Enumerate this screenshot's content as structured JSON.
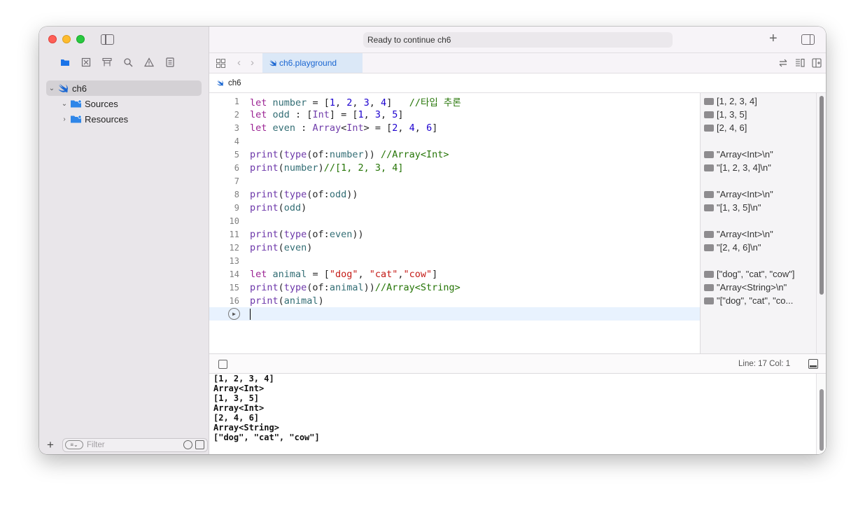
{
  "window": {
    "title": "Ready to continue ch6"
  },
  "navigator": {
    "tree": [
      {
        "label": "ch6",
        "expanded": true,
        "icon": "swift-icon"
      },
      {
        "label": "Sources",
        "expanded": true,
        "icon": "folder-icon"
      },
      {
        "label": "Resources",
        "expanded": false,
        "icon": "folder-icon"
      }
    ],
    "filter_placeholder": "Filter"
  },
  "tabs": {
    "active_file": "ch6.playground"
  },
  "jumpbar": {
    "path": "ch6"
  },
  "editor": {
    "lines": [
      {
        "no": "1",
        "html": "<span class=\"kw\">let</span> <span class=\"var\">number</span> = [<span class=\"num\">1</span>, <span class=\"num\">2</span>, <span class=\"num\">3</span>, <span class=\"num\">4</span>]   <span class=\"cmt\">//타입 추론</span>"
      },
      {
        "no": "2",
        "html": "<span class=\"kw\">let</span> <span class=\"var\">odd</span> : [<span class=\"typ\">Int</span>] = [<span class=\"num\">1</span>, <span class=\"num\">3</span>, <span class=\"num\">5</span>]"
      },
      {
        "no": "3",
        "html": "<span class=\"kw\">let</span> <span class=\"var\">even</span> : <span class=\"typ\">Array</span>&lt;<span class=\"typ\">Int</span>&gt; = [<span class=\"num\">2</span>, <span class=\"num\">4</span>, <span class=\"num\">6</span>]"
      },
      {
        "no": "4",
        "html": ""
      },
      {
        "no": "5",
        "html": "<span class=\"fn\">print</span>(<span class=\"fn\">type</span>(of:<span class=\"var\">number</span>)) <span class=\"cmt\">//Array&lt;Int&gt;</span>"
      },
      {
        "no": "6",
        "html": "<span class=\"fn\">print</span>(<span class=\"var\">number</span>)<span class=\"cmt\">//[1, 2, 3, 4]</span>"
      },
      {
        "no": "7",
        "html": ""
      },
      {
        "no": "8",
        "html": "<span class=\"fn\">print</span>(<span class=\"fn\">type</span>(of:<span class=\"var\">odd</span>))"
      },
      {
        "no": "9",
        "html": "<span class=\"fn\">print</span>(<span class=\"var\">odd</span>)"
      },
      {
        "no": "10",
        "html": ""
      },
      {
        "no": "11",
        "html": "<span class=\"fn\">print</span>(<span class=\"fn\">type</span>(of:<span class=\"var\">even</span>))"
      },
      {
        "no": "12",
        "html": "<span class=\"fn\">print</span>(<span class=\"var\">even</span>)"
      },
      {
        "no": "13",
        "html": ""
      },
      {
        "no": "14",
        "html": "<span class=\"kw\">let</span> <span class=\"var\">animal</span> = [<span class=\"str\">\"dog\"</span>, <span class=\"str\">\"cat\"</span>,<span class=\"str\">\"cow\"</span>]"
      },
      {
        "no": "15",
        "html": "<span class=\"fn\">print</span>(<span class=\"fn\">type</span>(of:<span class=\"var\">animal</span>))<span class=\"cmt\">//Array&lt;String&gt;</span>"
      },
      {
        "no": "16",
        "html": "<span class=\"fn\">print</span>(<span class=\"var\">animal</span>)"
      }
    ]
  },
  "results": [
    {
      "line": 1,
      "text": "[1, 2, 3, 4]"
    },
    {
      "line": 2,
      "text": "[1, 3, 5]"
    },
    {
      "line": 3,
      "text": "[2, 4, 6]"
    },
    {
      "line": 5,
      "text": "\"Array<Int>\\n\""
    },
    {
      "line": 6,
      "text": "\"[1, 2, 3, 4]\\n\""
    },
    {
      "line": 8,
      "text": "\"Array<Int>\\n\""
    },
    {
      "line": 9,
      "text": "\"[1, 3, 5]\\n\""
    },
    {
      "line": 11,
      "text": "\"Array<Int>\\n\""
    },
    {
      "line": 12,
      "text": "\"[2, 4, 6]\\n\""
    },
    {
      "line": 14,
      "text": "[\"dog\", \"cat\", \"cow\"]"
    },
    {
      "line": 15,
      "text": "\"Array<String>\\n\""
    },
    {
      "line": 16,
      "text": "\"[\"dog\", \"cat\", \"co..."
    }
  ],
  "debug": {
    "position": "Line: 17  Col: 1"
  },
  "console": {
    "lines": [
      "[1, 2, 3, 4]",
      "Array<Int>",
      "[1, 3, 5]",
      "Array<Int>",
      "[2, 4, 6]",
      "Array<String>",
      "[\"dog\", \"cat\", \"cow\"]"
    ]
  }
}
